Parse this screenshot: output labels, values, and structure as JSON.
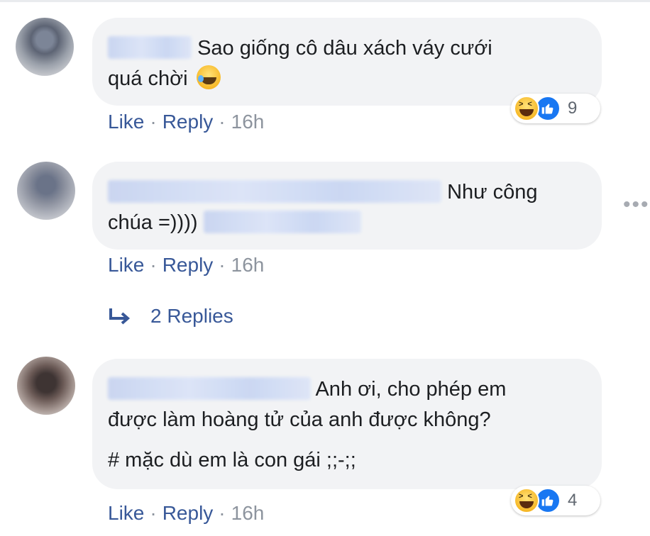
{
  "comments": [
    {
      "text_line1": "Sao giống cô dâu xách váy cưới",
      "text_line2": "quá chời",
      "reactions": {
        "count": "9",
        "icons": [
          "haha-icon",
          "like-icon"
        ]
      },
      "like_label": "Like",
      "reply_label": "Reply",
      "time": "16h"
    },
    {
      "text_line1": "Như công",
      "text_line2": "chúa =))))",
      "like_label": "Like",
      "reply_label": "Reply",
      "time": "16h",
      "replies_label": "2 Replies"
    },
    {
      "text_line1": "Anh ơi, cho phép em",
      "text_line2": "được làm hoàng tử của anh được không?",
      "text_line3": "# mặc dù em là con gái ;;-;;",
      "reactions": {
        "count": "4",
        "icons": [
          "haha-icon",
          "like-icon"
        ]
      },
      "like_label": "Like",
      "reply_label": "Reply",
      "time": "16h"
    }
  ],
  "separator": "·",
  "more_icon": "more-options-icon",
  "colors": {
    "link": "#385898",
    "bubble": "#f2f3f5",
    "meta": "#8d949e",
    "like_blue": "#1877f2"
  }
}
